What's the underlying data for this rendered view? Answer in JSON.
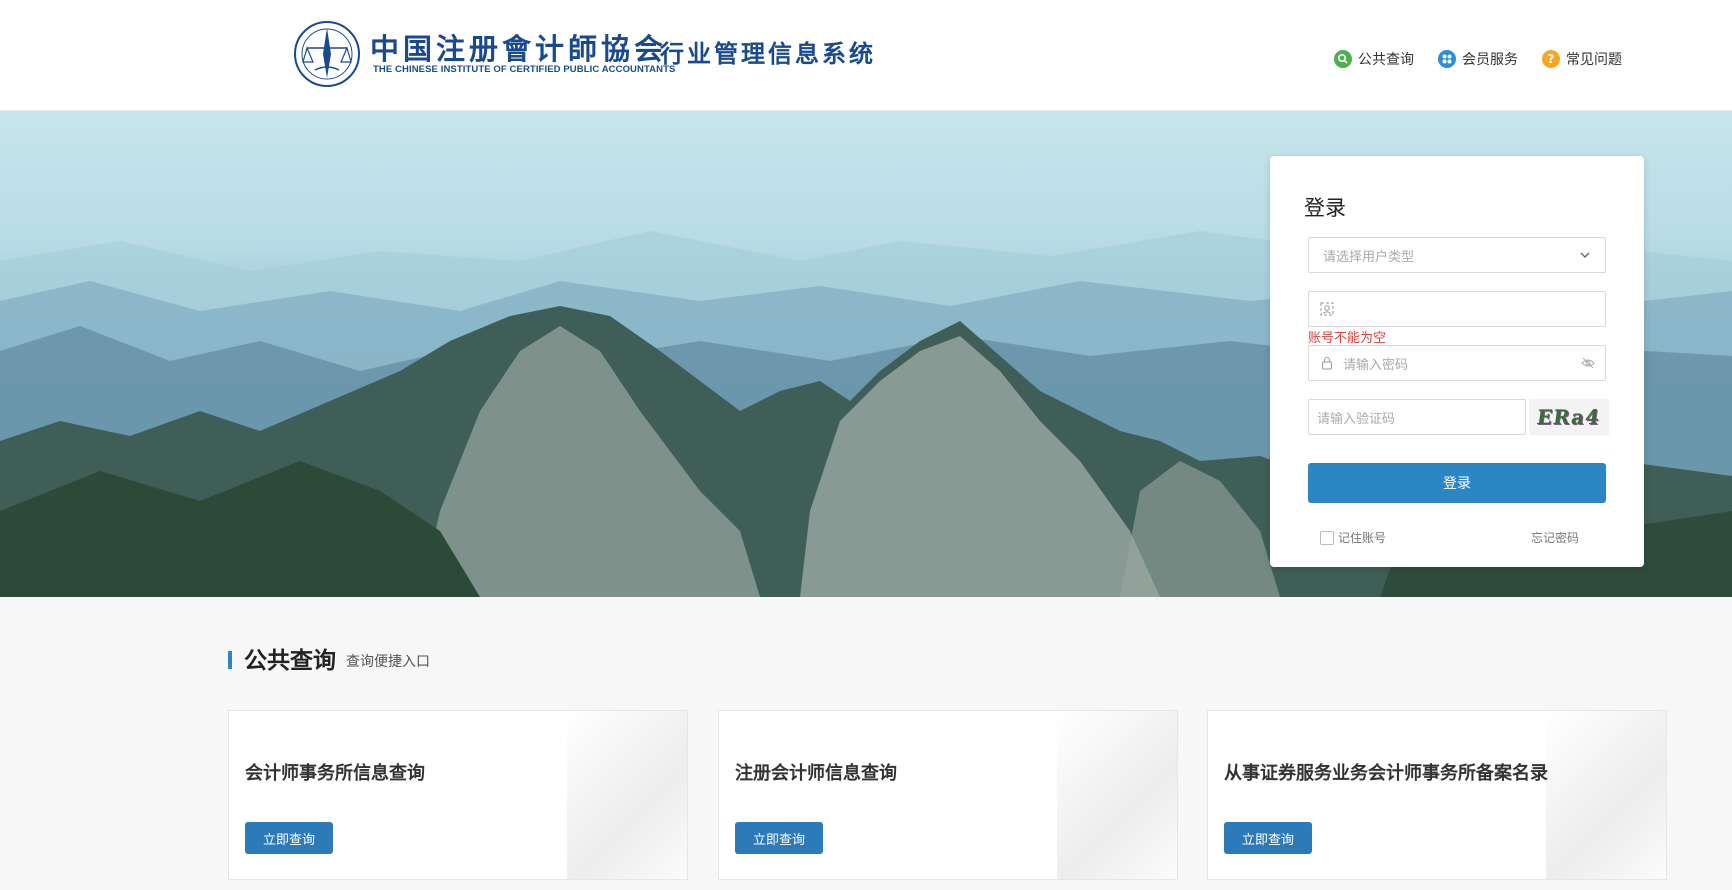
{
  "header": {
    "logo_cn": "中国注册會计師協会",
    "logo_en": "THE CHINESE INSTITUTE OF CERTIFIED PUBLIC ACCOUNTANTS",
    "system_name": "行业管理信息系统",
    "nav": [
      {
        "label": "公共查询",
        "icon": "search-icon",
        "color": "#4caf50"
      },
      {
        "label": "会员服务",
        "icon": "member-service-icon",
        "color": "#2a8fd6"
      },
      {
        "label": "常见问题",
        "icon": "question-icon",
        "color": "#f5a623"
      }
    ]
  },
  "login": {
    "title": "登录",
    "user_type_placeholder": "请选择用户类型",
    "account_value": "",
    "account_error": "账号不能为空",
    "password_placeholder": "请输入密码",
    "captcha_placeholder": "请输入验证码",
    "captcha_text": "ERa4",
    "submit_label": "登录",
    "remember_label": "记住账号",
    "forgot_label": "忘记密码"
  },
  "section": {
    "title": "公共查询",
    "subtitle": "查询便捷入口"
  },
  "cards": [
    {
      "title": "会计师事务所信息查询",
      "button": "立即查询"
    },
    {
      "title": "注册会计师信息查询",
      "button": "立即查询"
    },
    {
      "title": "从事证券服务业务会计师事务所备案名录",
      "button": "立即查询"
    }
  ],
  "colors": {
    "brand_blue": "#1a4a8e",
    "primary": "#2d86c4",
    "error": "#e0413a"
  }
}
